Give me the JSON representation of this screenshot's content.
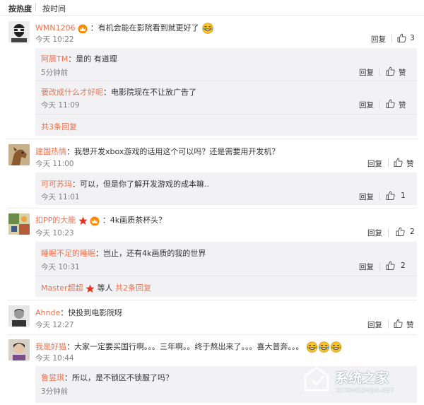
{
  "tabs": {
    "hot": "按热度",
    "time": "按时间"
  },
  "actions": {
    "reply": "回复",
    "like": "赞"
  },
  "colors": {
    "username": "#eb7350",
    "reply_bg": "#f2f2f5",
    "time": "#808080"
  },
  "comments": [
    {
      "user": "WMN1206",
      "text": "：有机会能在影院看到就更好了",
      "time": "今天 10:22",
      "likes": "3",
      "replies": [
        {
          "user": "阿晨TM",
          "text": "：是的 有道理",
          "time": "5分钟前"
        },
        {
          "user": "要改成什么才好呢",
          "text": "：电影院现在不让放广告了",
          "time": "今天 11:09"
        }
      ],
      "more": "共3条回复"
    },
    {
      "user": "建国热情",
      "text": "：我想开发xbox游戏的话用这个可以吗？还是需要用开发机？",
      "time": "今天 11:00",
      "replies": [
        {
          "user": "可可苏玛",
          "text": "：可以，但是你了解开发游戏的成本嘛..",
          "time": "今天 11:01",
          "likes": "1"
        }
      ]
    },
    {
      "user": "扣PP的大能",
      "text": "：4k画质茶杯头？",
      "time": "今天 10:23",
      "likes": "2",
      "replies": [
        {
          "user": "睡眠不足的睡眠",
          "text": "：岂止，还有4k画质的我的世界",
          "time": "今天 10:31",
          "likes": "2"
        }
      ],
      "more_user": "Master超超",
      "more_mid": "等人",
      "more": "共2条回复"
    },
    {
      "user": "Ahnde",
      "text": "：快投到电影院呀",
      "time": "今天 12:27"
    },
    {
      "user": "我是好猫",
      "text": "：大家一定要买国行啊。。。三年啊。。终于熬出来了。。。喜大普奔。。。",
      "time": "今天 10:44",
      "replies": [
        {
          "user": "鲁昱琪",
          "text": "：所以，是不锁区不锁服了吗？",
          "time": "3分钟前"
        }
      ]
    }
  ],
  "watermark": {
    "site": "系统之家",
    "url": "XITONGZHIJIA.NET"
  }
}
